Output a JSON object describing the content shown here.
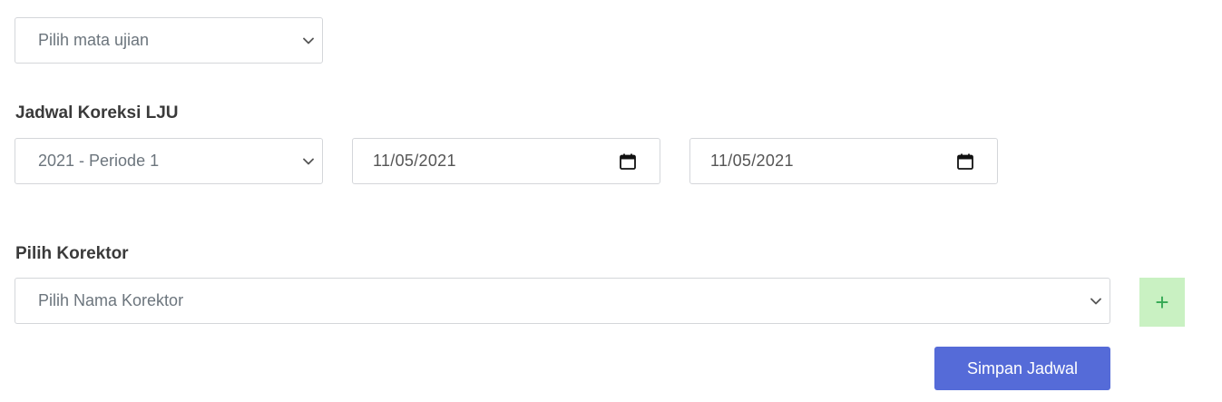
{
  "exam_select": {
    "value": "Pilih mata ujian"
  },
  "schedule": {
    "label": "Jadwal Koreksi LJU",
    "period_select": {
      "value": "2021 - Periode 1"
    },
    "start_date": {
      "value": "11/05/2021"
    },
    "end_date": {
      "value": "11/05/2021"
    }
  },
  "corrector": {
    "label": "Pilih Korektor",
    "select": {
      "value": "Pilih Nama Korektor"
    },
    "add_button": {
      "icon": "plus-icon",
      "glyph": "+",
      "color": "#34a853",
      "background": "#c9f1c2"
    }
  },
  "save_button": {
    "label": "Simpan Jadwal",
    "background": "#556bd8"
  }
}
